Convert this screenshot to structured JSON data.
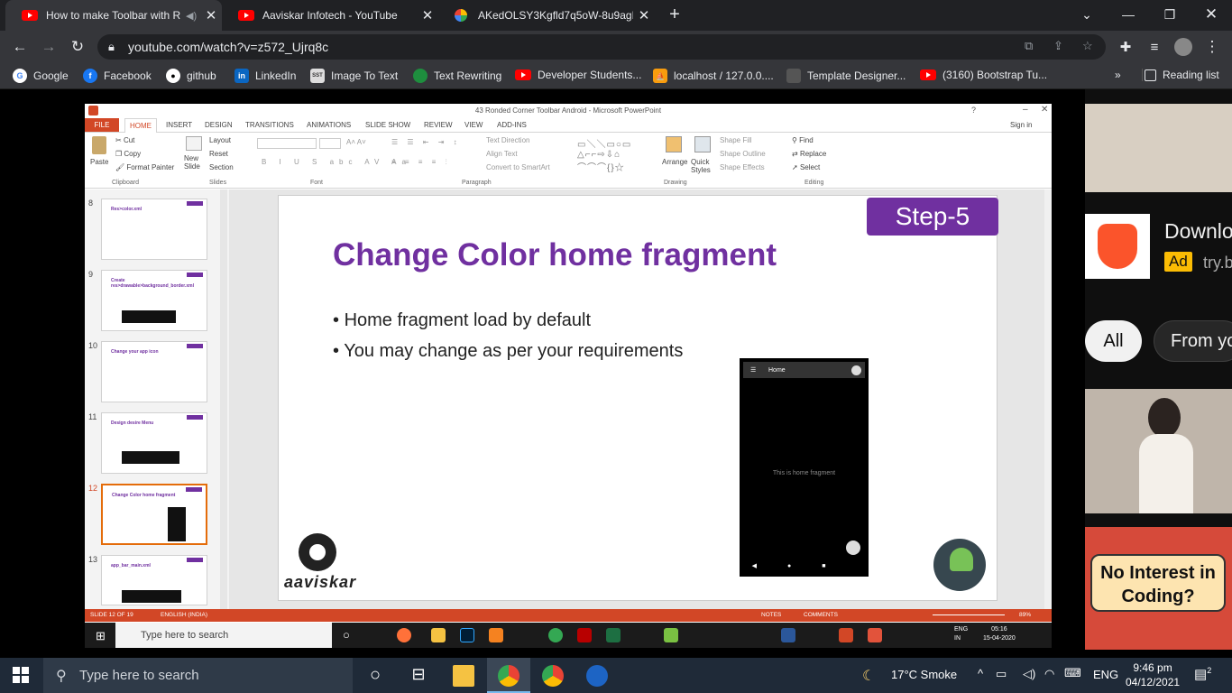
{
  "browser": {
    "tabs": [
      {
        "title": "How to make Toolbar with R",
        "icon": "youtube-icon",
        "active": true
      },
      {
        "title": "Aaviskar Infotech - YouTube",
        "icon": "youtube-icon"
      },
      {
        "title": "AKedOLSY3Kgfld7q5oW-8u9agD",
        "icon": "google-drive-icon"
      }
    ],
    "new_tab": "+",
    "url": "youtube.com/watch?v=z572_Ujrq8c",
    "bookmarks": [
      {
        "label": "Google",
        "icon": "google-icon",
        "color": "#4285f4"
      },
      {
        "label": "Facebook",
        "icon": "facebook-icon",
        "color": "#1877f2"
      },
      {
        "label": "github",
        "icon": "github-icon",
        "color": "#ffffff"
      },
      {
        "label": "LinkedIn",
        "icon": "linkedin-icon",
        "color": "#0a66c2"
      },
      {
        "label": "Image To Text",
        "icon": "sst-icon",
        "color": "#dddddd"
      },
      {
        "label": "Text Rewriting",
        "icon": "leaf-icon",
        "color": "#1e8e3e"
      },
      {
        "label": "Developer Students...",
        "icon": "youtube-icon",
        "color": "#ff0000"
      },
      {
        "label": "localhost / 127.0.0....",
        "icon": "phpmyadmin-icon",
        "color": "#f89c0e"
      },
      {
        "label": "Template Designer...",
        "icon": "template-icon",
        "color": "#555555"
      },
      {
        "label": "(3160) Bootstrap Tu...",
        "icon": "youtube-icon",
        "color": "#ff0000"
      }
    ],
    "bookmarks_more": "»",
    "reading_list": "Reading list"
  },
  "ppt": {
    "window_title": "43 Ronded Corner Toolbar Android - Microsoft PowerPoint",
    "sign_in": "Sign in",
    "ribbon_tabs": [
      "FILE",
      "HOME",
      "INSERT",
      "DESIGN",
      "TRANSITIONS",
      "ANIMATIONS",
      "SLIDE SHOW",
      "REVIEW",
      "VIEW",
      "ADD-INS"
    ],
    "groups": {
      "clipboard": "Clipboard",
      "slides": "Slides",
      "font": "Font",
      "paragraph": "Paragraph",
      "drawing": "Drawing",
      "editing": "Editing"
    },
    "buttons": {
      "paste": "Paste",
      "cut": "Cut",
      "copy": "Copy",
      "format_painter": "Format Painter",
      "new_slide": "New Slide",
      "layout": "Layout",
      "reset": "Reset",
      "section": "Section",
      "text_direction": "Text Direction",
      "align_text": "Align Text",
      "convert_smartart": "Convert to SmartArt",
      "arrange": "Arrange",
      "quick_styles": "Quick Styles",
      "shape_fill": "Shape Fill",
      "shape_outline": "Shape Outline",
      "shape_effects": "Shape Effects",
      "find": "Find",
      "replace": "Replace",
      "select": "Select"
    },
    "thumbnails": [
      {
        "num": "8",
        "title": "Res>color.xml"
      },
      {
        "num": "9",
        "title": "Create res>drawable>background_border.xml"
      },
      {
        "num": "10",
        "title": "Change your app icon"
      },
      {
        "num": "11",
        "title": "Design desire Menu"
      },
      {
        "num": "12",
        "title": "Change Color home fragment",
        "selected": true
      },
      {
        "num": "13",
        "title": "app_bar_main.xml"
      }
    ],
    "slide": {
      "step": "Step-5",
      "title": "Change Color home fragment",
      "bullets": [
        "Home fragment load by default",
        "You may change as per your requirements"
      ],
      "phone_title": "Home",
      "phone_message": "This is home fragment",
      "logo_text": "aaviskar"
    },
    "status": {
      "slide": "SLIDE 12 OF 19",
      "language": "ENGLISH (INDIA)",
      "notes": "NOTES",
      "comments": "COMMENTS",
      "zoom": "89%"
    },
    "accent": "#d24726",
    "purple": "#7030a0"
  },
  "inner_taskbar": {
    "search": "Type here to search",
    "lang": "ENG",
    "region": "IN",
    "time": "05:16",
    "date": "15-04-2020"
  },
  "sidebar": {
    "ad_title": "Downlo",
    "ad_badge": "Ad",
    "ad_url": "try.b",
    "chips": [
      "All",
      "From yo"
    ],
    "thumb_text": "No Interest in Coding?"
  },
  "taskbar": {
    "search": "Type here to search",
    "weather": "17°C  Smoke",
    "lang": "ENG",
    "time": "9:46 pm",
    "date": "04/12/2021",
    "notifications": "2"
  }
}
